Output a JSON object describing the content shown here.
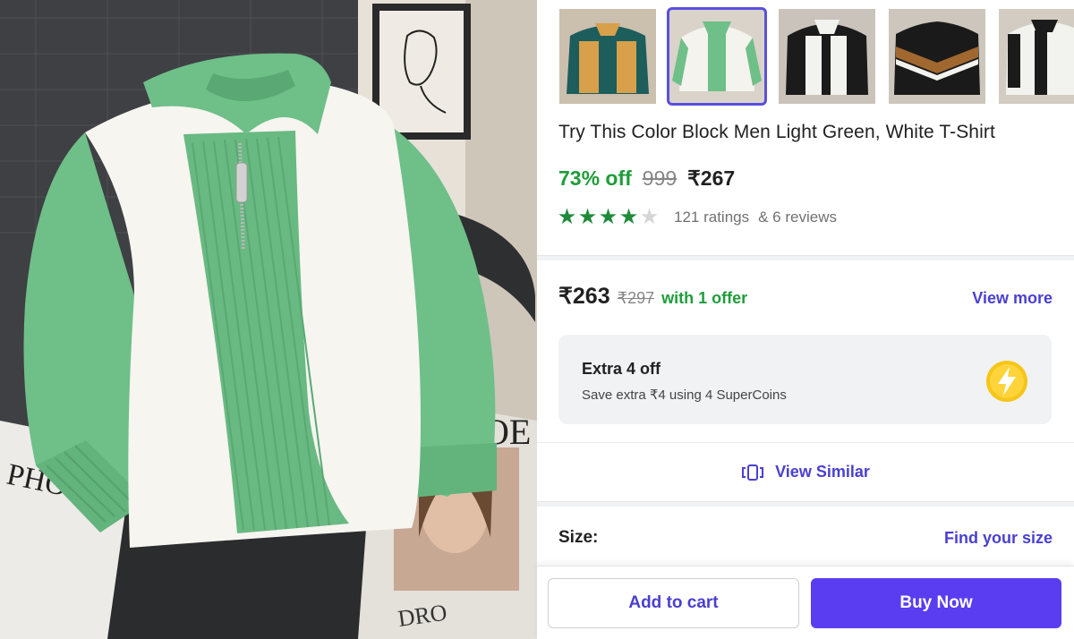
{
  "photo": {
    "book_text_left": "PHO LIF",
    "book_text_right": "DRO",
    "magazine_text": "OE"
  },
  "thumbnails": [
    {
      "name": "teal-mustard-polo",
      "selected": false
    },
    {
      "name": "light-green-white-polo",
      "selected": true
    },
    {
      "name": "black-white-polo",
      "selected": false
    },
    {
      "name": "black-brown-chevron-sweater",
      "selected": false
    },
    {
      "name": "white-black-polo",
      "selected": false
    }
  ],
  "product": {
    "title": "Try This Color Block Men Light Green, White T-Shirt",
    "discount": "73% off",
    "mrp": "999",
    "price": "₹267",
    "rating_value": 4,
    "rating_max": 5,
    "ratings_text": "121 ratings",
    "reviews_text": "& 6 reviews"
  },
  "offer": {
    "price": "₹263",
    "mrp": "₹297",
    "text": "with 1 offer",
    "view_more": "View more"
  },
  "supercoins": {
    "title": "Extra 4 off",
    "subtitle": "Save extra ₹4 using 4 SuperCoins"
  },
  "view_similar": {
    "label": "View Similar"
  },
  "size": {
    "label": "Size:",
    "find_size": "Find your size"
  },
  "actions": {
    "add_to_cart": "Add to cart",
    "buy_now": "Buy Now"
  },
  "colors": {
    "accent": "#4a3fd0",
    "buy_button": "#5a3df0",
    "green_discount": "#1f9d3a",
    "star_green": "#1f8b3a",
    "shirt_green": "#6bbf85",
    "shirt_white": "#f6f5f0"
  }
}
